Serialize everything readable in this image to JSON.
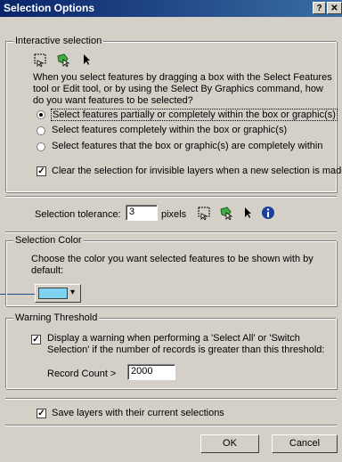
{
  "window": {
    "title": "Selection Options",
    "help_glyph": "?",
    "close_glyph": "✕"
  },
  "interactive": {
    "legend": "Interactive selection",
    "description": "When you select features by dragging a box with the Select Features tool or Edit tool, or by using the Select By Graphics command, how do you want features to be selected?",
    "options": [
      "Select features partially or completely within the box or graphic(s)",
      "Select features completely within the box or graphic(s)",
      "Select features that the box or graphic(s) are completely within"
    ],
    "selected_index": 0,
    "clear_label": "Clear the selection for invisible layers when a new selection is made",
    "clear_checked": true
  },
  "tolerance": {
    "label": "Selection tolerance:",
    "value": "3",
    "units": "pixels"
  },
  "color": {
    "legend": "Selection Color",
    "description": "Choose the color you want selected features to be shown with by default:",
    "swatch": "#7fd3f0",
    "dropdown_glyph": "▾"
  },
  "warning": {
    "legend": "Warning Threshold",
    "display_label": "Display a warning when performing a 'Select All' or 'Switch Selection' if the number of records is greater than this threshold:",
    "display_checked": true,
    "record_label": "Record Count >",
    "record_value": "2000"
  },
  "save": {
    "label": "Save layers with their current selections",
    "checked": true
  },
  "buttons": {
    "ok": "OK",
    "cancel": "Cancel"
  },
  "check_glyph": "✓"
}
